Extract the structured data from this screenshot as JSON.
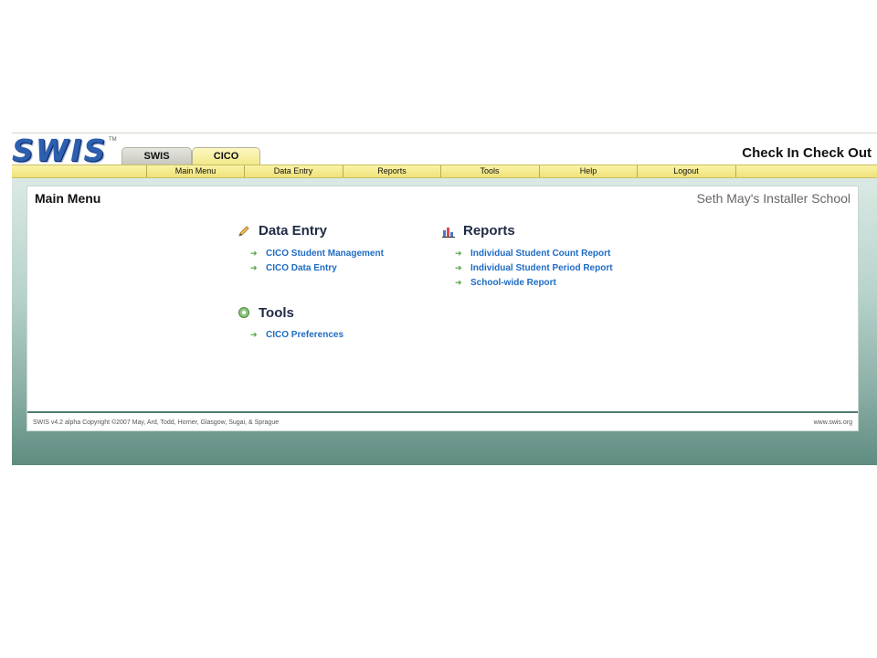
{
  "logo": {
    "text": "SWIS",
    "tm": "TM"
  },
  "app_tabs": [
    {
      "label": "SWIS"
    },
    {
      "label": "CICO"
    }
  ],
  "app_title": "Check In Check Out",
  "nav": [
    {
      "label": "Main Menu"
    },
    {
      "label": "Data Entry"
    },
    {
      "label": "Reports"
    },
    {
      "label": "Tools"
    },
    {
      "label": "Help"
    },
    {
      "label": "Logout"
    }
  ],
  "page_title": "Main Menu",
  "school_name": "Seth May's Installer School",
  "sections": {
    "data_entry": {
      "title": "Data Entry",
      "icon": "pencil-icon",
      "links": [
        "CICO Student Management",
        "CICO Data Entry"
      ]
    },
    "reports": {
      "title": "Reports",
      "icon": "bar-chart-icon",
      "links": [
        "Individual Student Count Report",
        "Individual Student Period Report",
        "School-wide Report"
      ]
    },
    "tools": {
      "title": "Tools",
      "icon": "gear-icon",
      "links": [
        "CICO Preferences"
      ]
    }
  },
  "footer": {
    "copyright": "SWIS v4.2 alpha Copyright ©2007 May, Ard, Todd, Horner, Glasgow, Sugai, & Sprague",
    "site": "www.swis.org"
  },
  "colors": {
    "link": "#1f6cc4",
    "arrow": "#4da03a",
    "navbar": "#f5ea8c",
    "section_title": "#1f2a44"
  }
}
